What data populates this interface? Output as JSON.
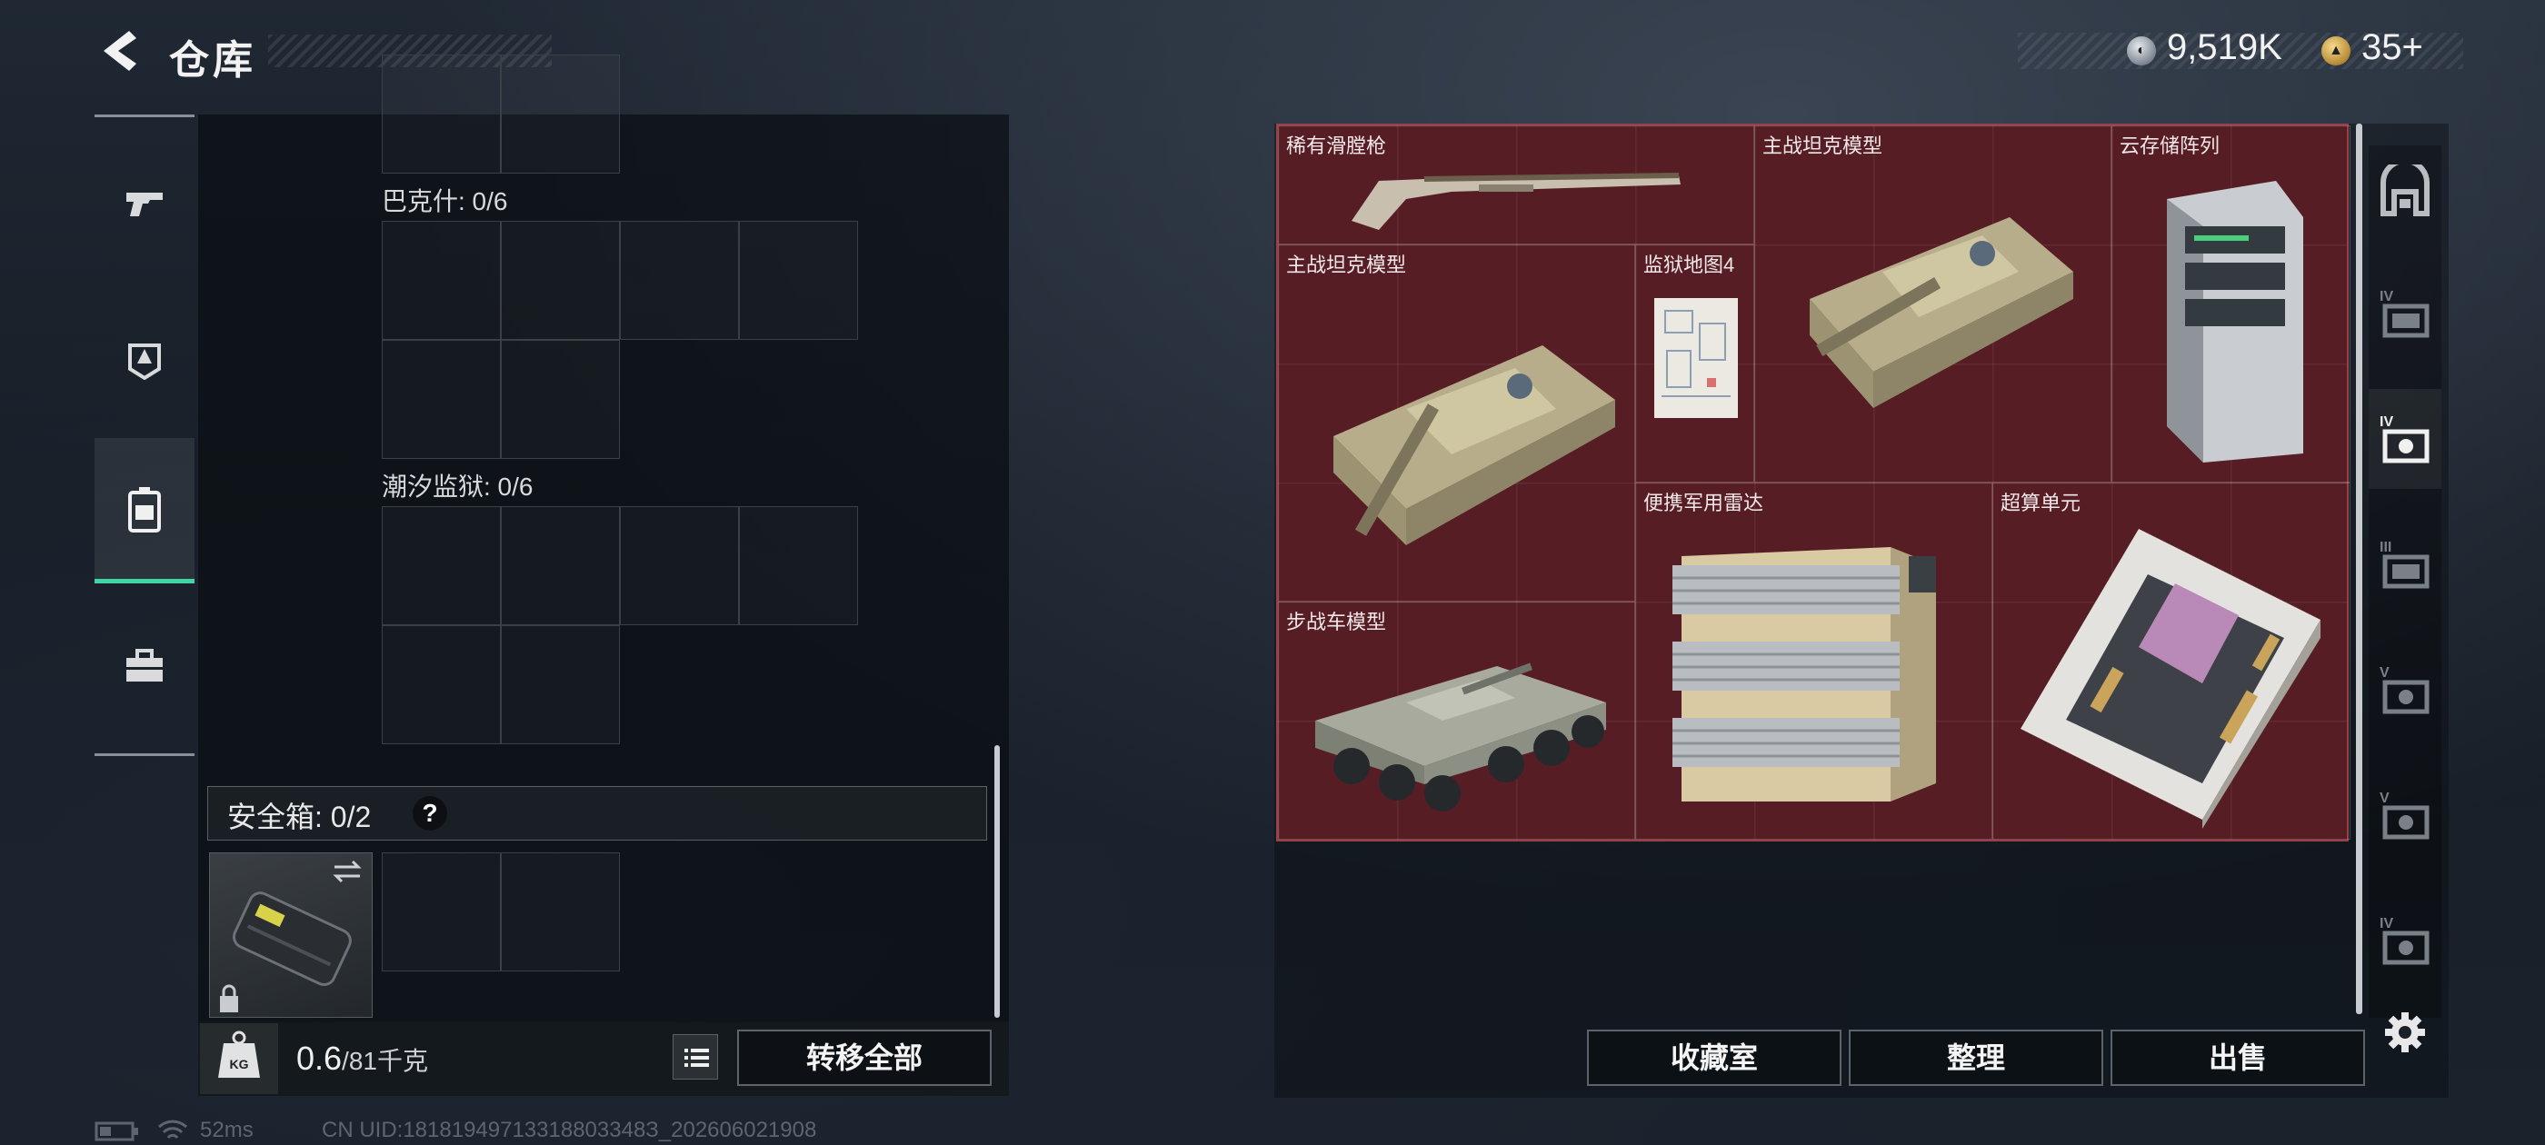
{
  "header": {
    "title": "仓库",
    "currencies": [
      {
        "icon": "silver-coin-icon",
        "value": "9,519K"
      },
      {
        "icon": "gold-coin-icon",
        "value": "35+"
      }
    ]
  },
  "left_rail": [
    {
      "name": "weapons",
      "icon": "pistol-icon"
    },
    {
      "name": "armor",
      "icon": "helmet-icon"
    },
    {
      "name": "backpack",
      "icon": "backpack-icon",
      "active": true
    },
    {
      "name": "toolbox",
      "icon": "toolbox-icon"
    }
  ],
  "inventory": {
    "sections": [
      {
        "label": "巴克什: 0/6"
      },
      {
        "label": "潮汐监狱: 0/6"
      }
    ],
    "safebox": {
      "label": "安全箱: 0/2",
      "help": "?"
    },
    "weight": {
      "current": "0.6",
      "max": "/81千克"
    },
    "transfer_all": "转移全部"
  },
  "stash": {
    "items": [
      {
        "name": "稀有滑膛枪"
      },
      {
        "name": "主战坦克模型"
      },
      {
        "name": "云存储阵列"
      },
      {
        "name": "主战坦克模型"
      },
      {
        "name": "监狱地图4"
      },
      {
        "name": "便携军用雷达"
      },
      {
        "name": "超算单元"
      },
      {
        "name": "步战车模型"
      }
    ],
    "buttons": {
      "vault": "收藏室",
      "sort": "整理",
      "sell": "出售"
    }
  },
  "right_rail": [
    {
      "icon": "home-vault-icon"
    },
    {
      "icon": "tier-iv-case-icon",
      "tier": "IV"
    },
    {
      "icon": "tier-iv-case-active-icon",
      "tier": "IV",
      "active": true
    },
    {
      "icon": "tier-iii-case-icon",
      "tier": "III"
    },
    {
      "icon": "tier-v-case-icon",
      "tier": "V"
    },
    {
      "icon": "tier-v-case-icon",
      "tier": "V"
    },
    {
      "icon": "tier-iv-case-icon",
      "tier": "IV"
    },
    {
      "icon": "gear-icon"
    }
  ],
  "status_bar": {
    "latency": "52ms",
    "uid": "CN UID:18181949713318803348З_202606021908"
  },
  "colors": {
    "accent": "#3fd6a4",
    "stash_bg": "#571d25"
  }
}
